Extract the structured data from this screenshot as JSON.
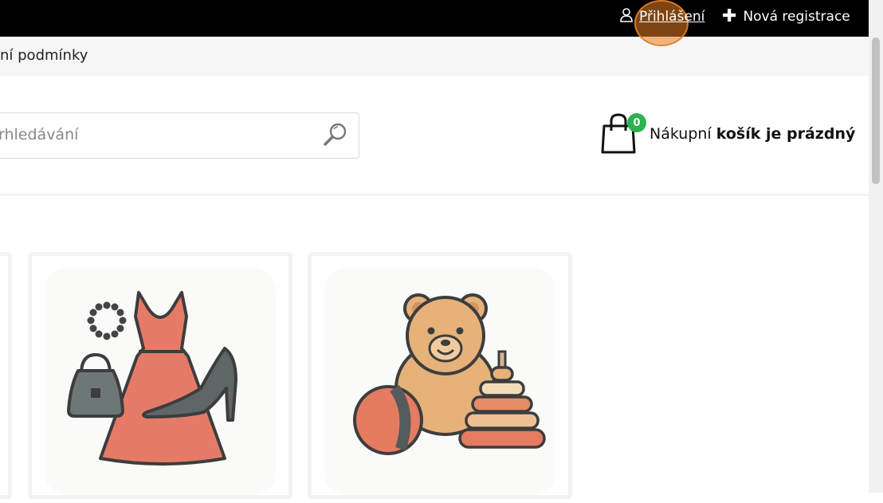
{
  "header": {
    "login_label": "Přihlášení",
    "register_label": "Nová registrace"
  },
  "subnav": {
    "terms_label": "ní podmínky"
  },
  "search": {
    "placeholder": "rhledávání"
  },
  "cart": {
    "count": "0",
    "text_prefix": "Nákupní",
    "text_bold": "košík je prázdný"
  },
  "colors": {
    "topbar": "#000000",
    "accent_click": "#e67e22",
    "badge": "#2bb24c"
  },
  "icons": [
    "user-icon",
    "plus-icon",
    "search-icon",
    "shopping-bag-icon"
  ]
}
